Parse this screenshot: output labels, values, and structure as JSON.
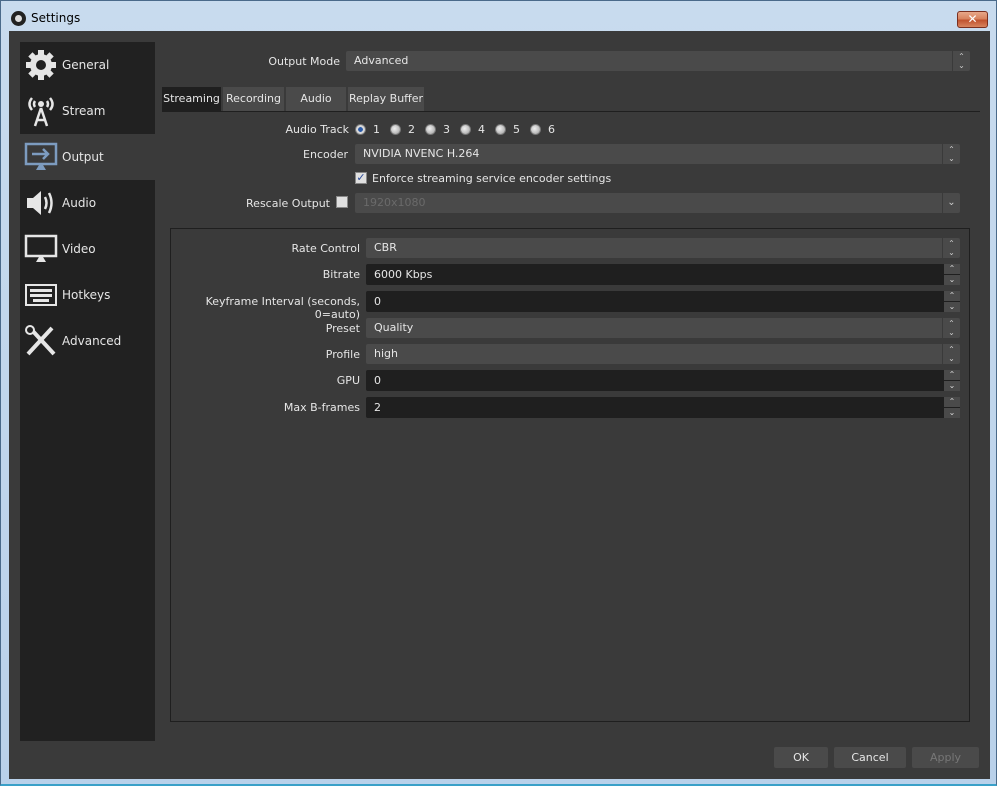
{
  "window": {
    "title": "Settings",
    "close_label": "✕"
  },
  "sidebar": {
    "items": [
      {
        "label": "General",
        "icon": "gear-icon",
        "active": false
      },
      {
        "label": "Stream",
        "icon": "antenna-icon",
        "active": false
      },
      {
        "label": "Output",
        "icon": "monitor-arrow-icon",
        "active": true
      },
      {
        "label": "Audio",
        "icon": "speaker-icon",
        "active": false
      },
      {
        "label": "Video",
        "icon": "monitor-icon",
        "active": false
      },
      {
        "label": "Hotkeys",
        "icon": "keyboard-icon",
        "active": false
      },
      {
        "label": "Advanced",
        "icon": "tools-icon",
        "active": false
      }
    ]
  },
  "output_mode": {
    "label": "Output Mode",
    "value": "Advanced"
  },
  "tabs": [
    {
      "label": "Streaming",
      "active": true
    },
    {
      "label": "Recording",
      "active": false
    },
    {
      "label": "Audio",
      "active": false
    },
    {
      "label": "Replay Buffer",
      "active": false
    }
  ],
  "streaming": {
    "audio_track": {
      "label": "Audio Track",
      "options": [
        "1",
        "2",
        "3",
        "4",
        "5",
        "6"
      ],
      "selected": "1"
    },
    "encoder": {
      "label": "Encoder",
      "value": "NVIDIA NVENC H.264"
    },
    "enforce": {
      "label": "Enforce streaming service encoder settings",
      "checked": true
    },
    "rescale": {
      "label": "Rescale Output",
      "checked": false,
      "value": "1920x1080"
    },
    "encoder_settings": {
      "rate_control": {
        "label": "Rate Control",
        "value": "CBR"
      },
      "bitrate": {
        "label": "Bitrate",
        "value": "6000 Kbps"
      },
      "keyframe": {
        "label": "Keyframe Interval (seconds, 0=auto)",
        "value": "0"
      },
      "preset": {
        "label": "Preset",
        "value": "Quality"
      },
      "profile": {
        "label": "Profile",
        "value": "high"
      },
      "gpu": {
        "label": "GPU",
        "value": "0"
      },
      "bframes": {
        "label": "Max B-frames",
        "value": "2"
      }
    }
  },
  "buttons": {
    "ok": "OK",
    "cancel": "Cancel",
    "apply": "Apply"
  },
  "glyphs": {
    "up": "⌃",
    "down": "⌄",
    "check": "✓"
  }
}
